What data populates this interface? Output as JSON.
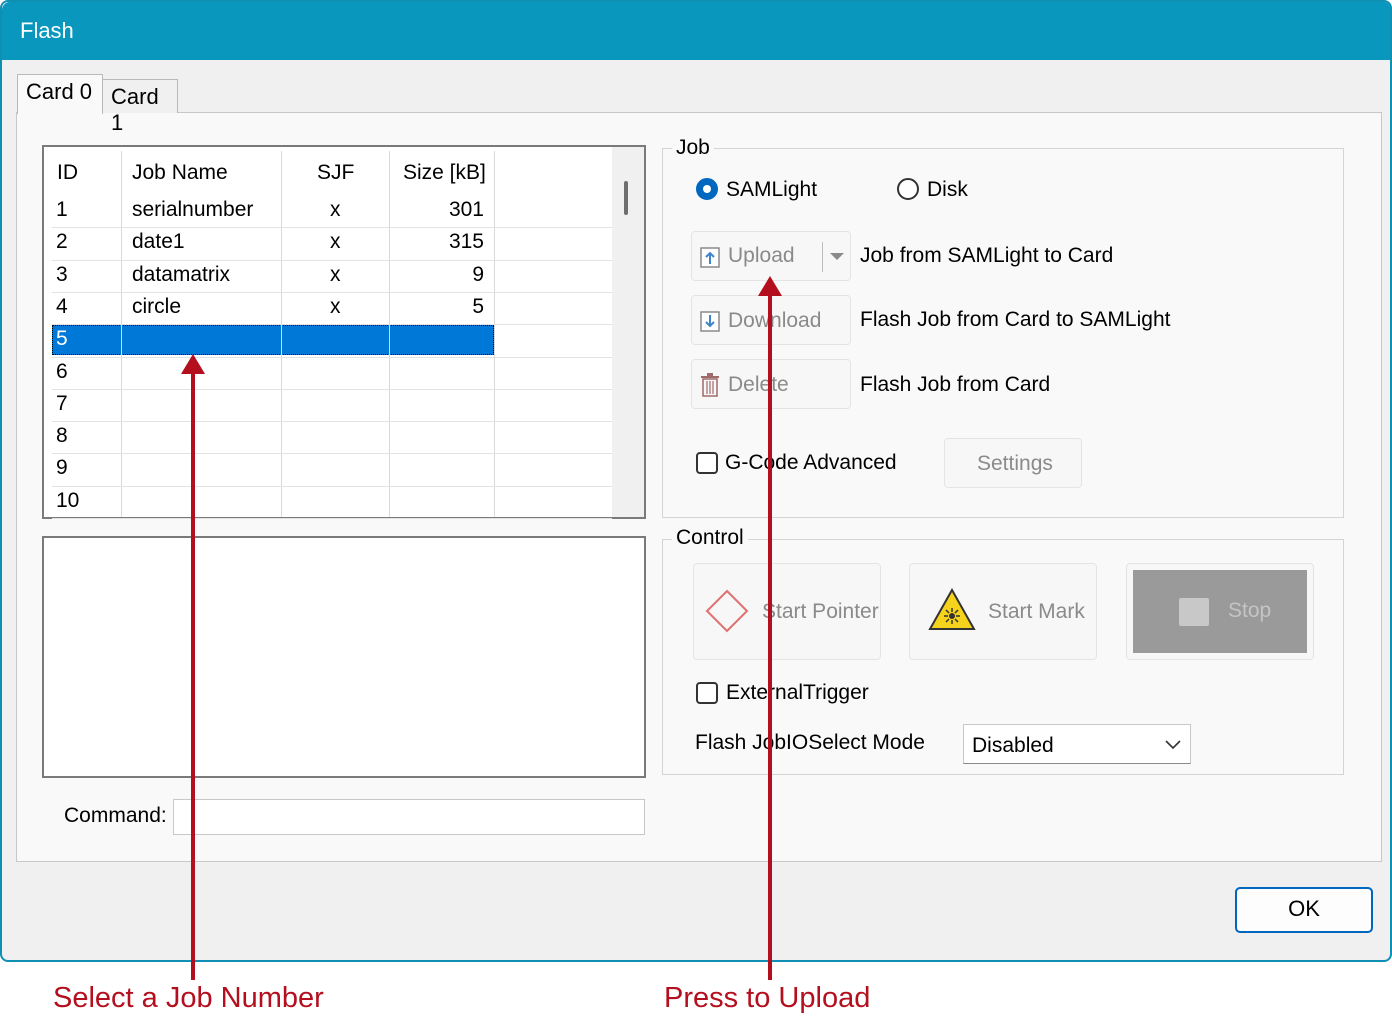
{
  "window": {
    "title": "Flash"
  },
  "tabs": [
    "Card 0",
    "Card 1"
  ],
  "grid": {
    "columns": [
      "ID",
      "Job Name",
      "SJF",
      "Size [kB]"
    ],
    "rows": [
      [
        "1",
        "serialnumber",
        "x",
        "301"
      ],
      [
        "2",
        "date1",
        "x",
        "315"
      ],
      [
        "3",
        "datamatrix",
        "x",
        "9"
      ],
      [
        "4",
        "circle",
        "x",
        "5"
      ],
      [
        "5",
        "",
        "",
        ""
      ],
      [
        "6",
        "",
        "",
        ""
      ],
      [
        "7",
        "",
        "",
        ""
      ],
      [
        "8",
        "",
        "",
        ""
      ],
      [
        "9",
        "",
        "",
        ""
      ],
      [
        "10",
        "",
        "",
        ""
      ]
    ],
    "selected_row": "5"
  },
  "command": {
    "label": "Command:",
    "value": ""
  },
  "job": {
    "title": "Job",
    "radio_samlight": "SAMLight",
    "radio_disk": "Disk",
    "selected": "SAMLight",
    "upload_label": "Upload",
    "upload_desc": "Job from SAMLight to Card",
    "download_label": "Download",
    "download_desc": "Flash Job from Card to SAMLight",
    "delete_label": "Delete",
    "delete_desc": "Flash Job from Card",
    "gcode_label": "G-Code Advanced",
    "settings_label": "Settings"
  },
  "control": {
    "title": "Control",
    "start_pointer": "Start Pointer",
    "start_mark": "Start Mark",
    "stop": "Stop",
    "external_trigger": "ExternalTrigger",
    "io_mode_label": "Flash JobIOSelect Mode",
    "io_mode_value": "Disabled"
  },
  "ok_label": "OK",
  "annotations": {
    "left": "Select a Job Number",
    "right": "Press to Upload",
    "color": "#b40f1e"
  },
  "colors": {
    "titlebar": "#0997bd",
    "selection": "#0078d7",
    "accent": "#0067c0"
  }
}
